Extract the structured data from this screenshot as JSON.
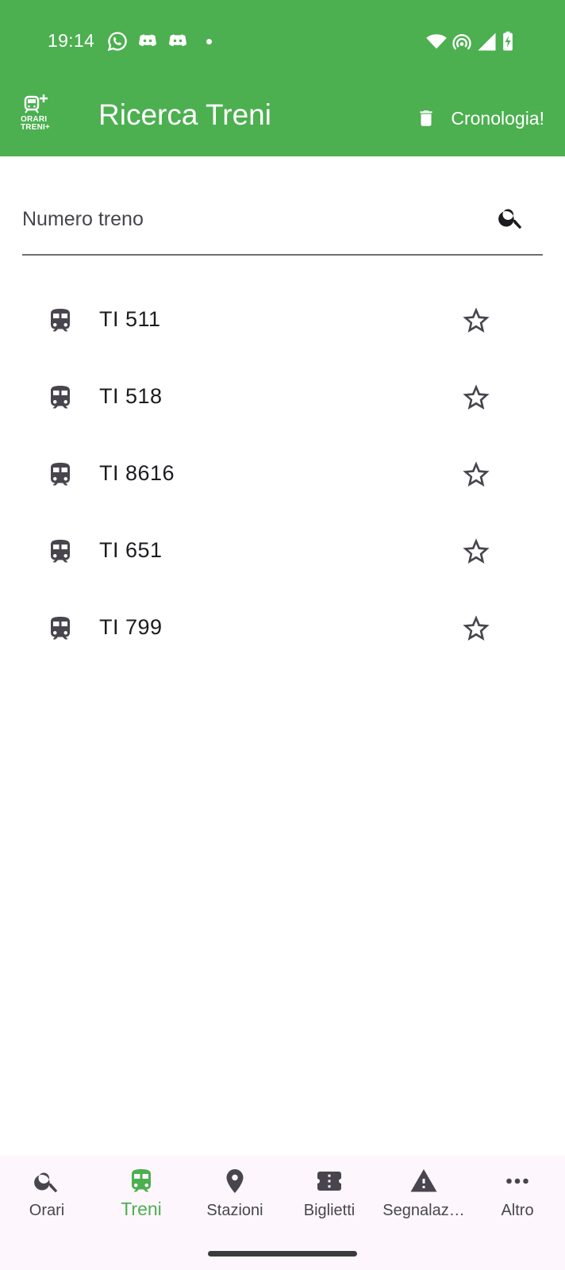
{
  "status_bar": {
    "time": "19:14",
    "icons": [
      "whatsapp-icon",
      "discord-icon",
      "discord-icon",
      "notification-dot",
      "wifi-icon",
      "hotspot-icon",
      "signal-icon",
      "battery-charging-icon"
    ]
  },
  "header": {
    "logo_text_line1": "ORARI",
    "logo_text_line2": "TRENI+",
    "title": "Ricerca Treni",
    "history_label": "Cronologia!"
  },
  "search": {
    "placeholder": "Numero treno",
    "value": ""
  },
  "trains": [
    {
      "label": "TI 511",
      "favorite": false
    },
    {
      "label": "TI 518",
      "favorite": false
    },
    {
      "label": "TI 8616",
      "favorite": false
    },
    {
      "label": "TI 651",
      "favorite": false
    },
    {
      "label": "TI 799",
      "favorite": false
    }
  ],
  "bottom_nav": {
    "items": [
      {
        "label": "Orari",
        "icon": "search-icon",
        "active": false
      },
      {
        "label": "Treni",
        "icon": "train-icon",
        "active": true
      },
      {
        "label": "Stazioni",
        "icon": "location-pin-icon",
        "active": false
      },
      {
        "label": "Biglietti",
        "icon": "ticket-icon",
        "active": false
      },
      {
        "label": "Segnalaz…",
        "icon": "warning-icon",
        "active": false
      },
      {
        "label": "Altro",
        "icon": "more-horizontal-icon",
        "active": false
      }
    ]
  },
  "colors": {
    "primary": "#4caf50",
    "icon_dark": "#49454f",
    "nav_background": "#fdf7fd"
  }
}
